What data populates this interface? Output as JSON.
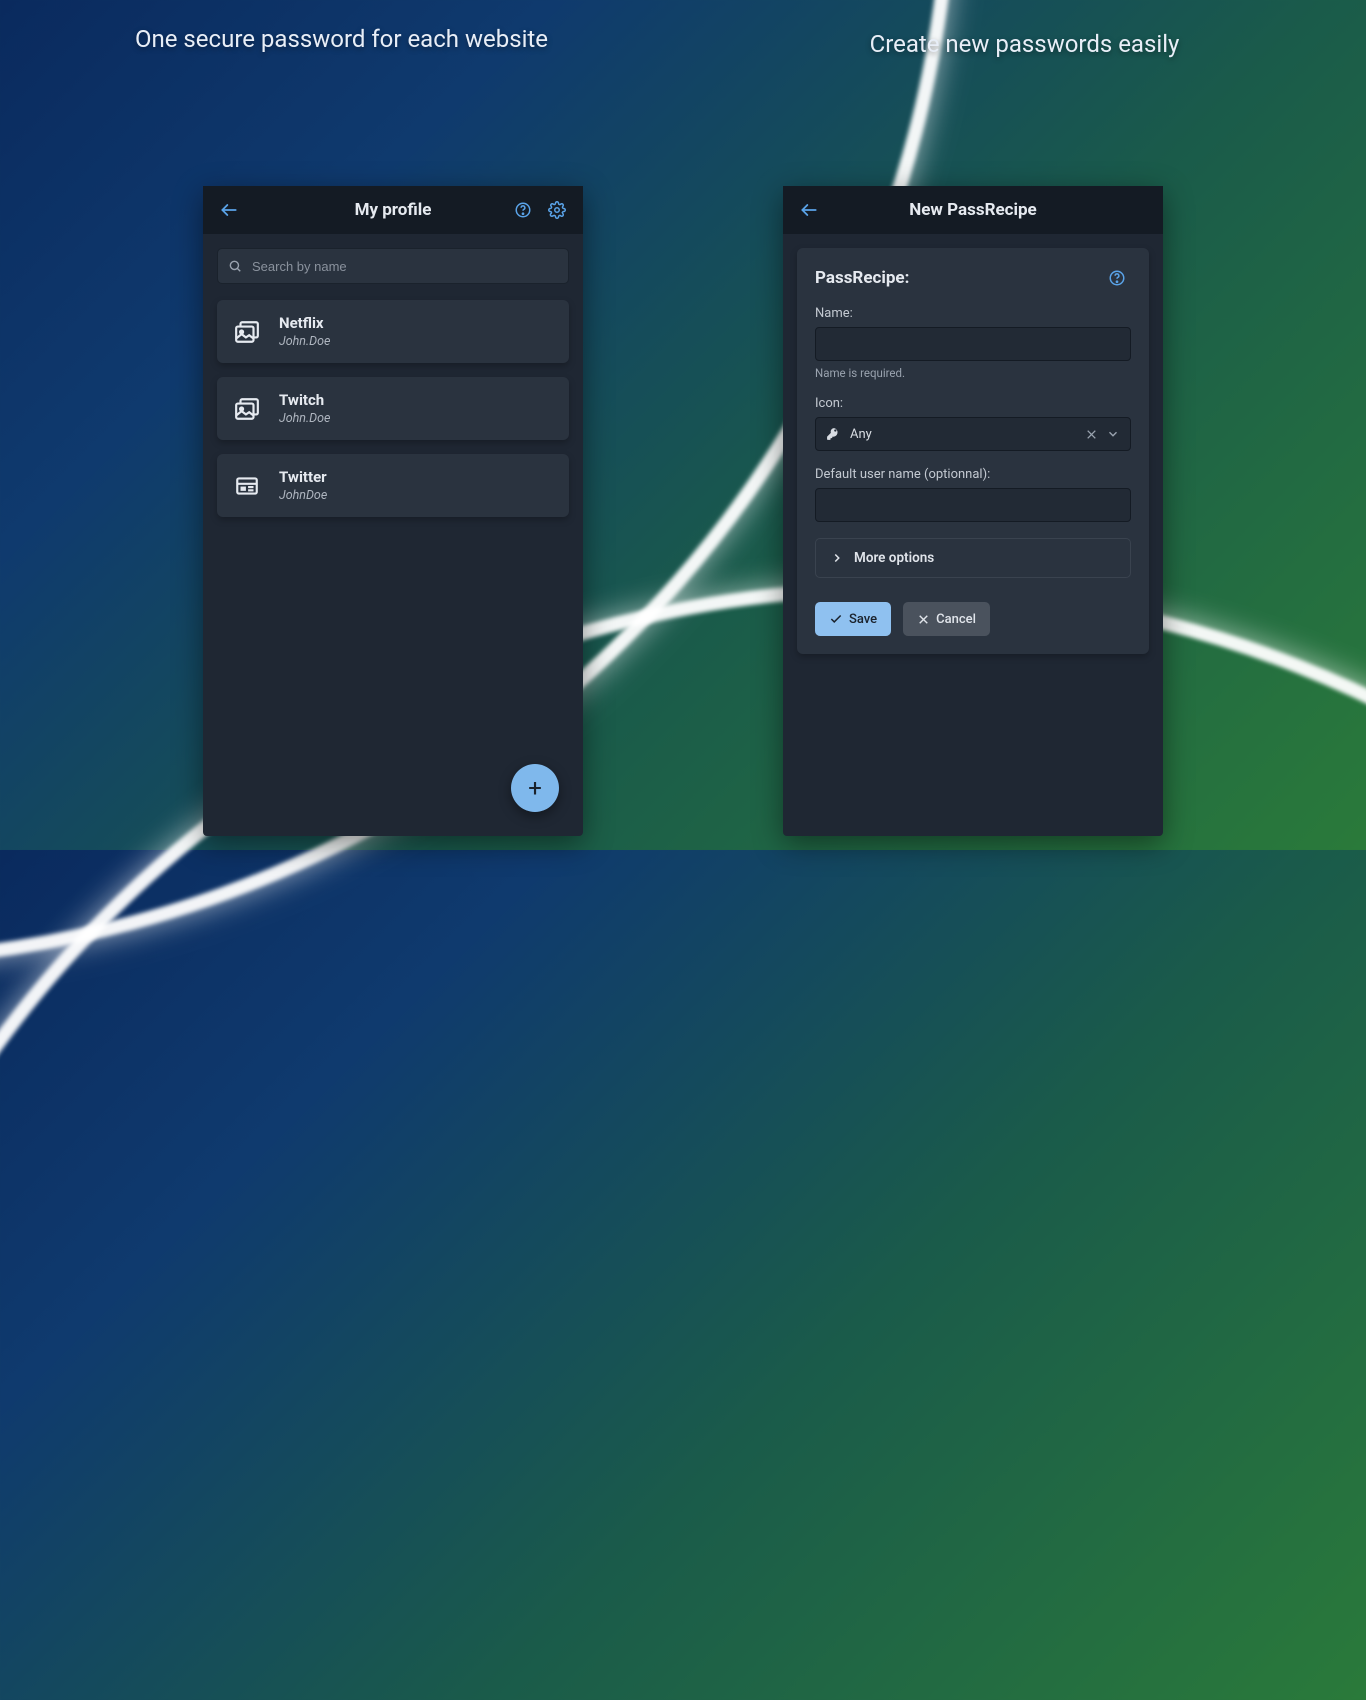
{
  "captions": {
    "left": "One secure password for each website",
    "right": "Create new passwords easily"
  },
  "left_phone": {
    "title": "My profile",
    "search_placeholder": "Search by name",
    "items": [
      {
        "name": "Netflix",
        "user": "John.Doe"
      },
      {
        "name": "Twitch",
        "user": "John.Doe"
      },
      {
        "name": "Twitter",
        "user": "JohnDoe"
      }
    ],
    "fab_label": "+"
  },
  "right_phone": {
    "title": "New PassRecipe",
    "form_heading": "PassRecipe:",
    "name_label": "Name:",
    "name_help": "Name is required.",
    "icon_label": "Icon:",
    "icon_value": "Any",
    "username_label": "Default user name (optionnal):",
    "more_options": "More options",
    "save_label": "Save",
    "cancel_label": "Cancel"
  }
}
